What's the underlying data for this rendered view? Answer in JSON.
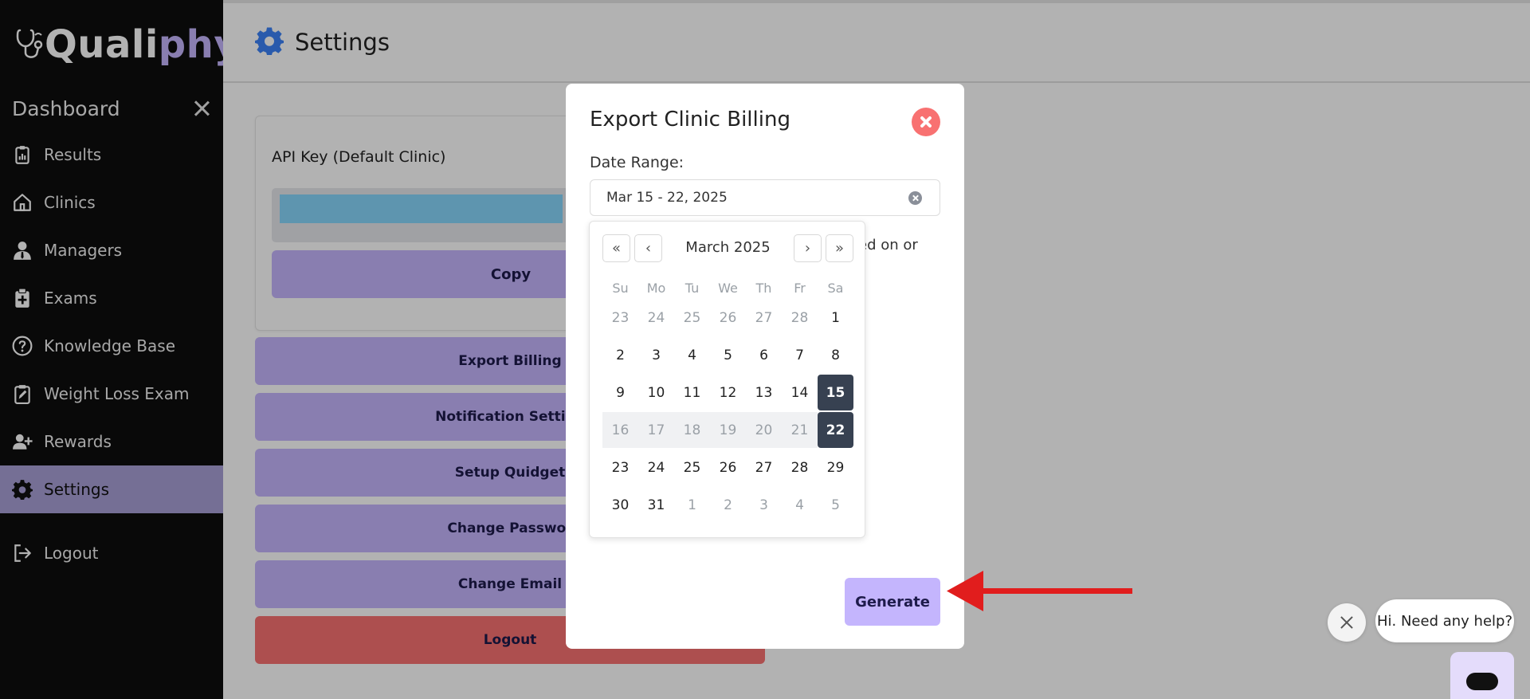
{
  "app": {
    "logo_text_a": "Quali",
    "logo_text_b": "phy"
  },
  "sidebar": {
    "title": "Dashboard",
    "items": [
      {
        "label": "Results",
        "icon": "clipboard-icon"
      },
      {
        "label": "Clinics",
        "icon": "home-icon"
      },
      {
        "label": "Managers",
        "icon": "user-tie-icon"
      },
      {
        "label": "Exams",
        "icon": "clipboard-plus-icon"
      },
      {
        "label": "Knowledge Base",
        "icon": "question-circle-icon"
      },
      {
        "label": "Weight Loss Exam",
        "icon": "clipboard-edit-icon"
      },
      {
        "label": "Rewards",
        "icon": "user-plus-icon"
      },
      {
        "label": "Settings",
        "icon": "gear-icon",
        "active": true
      }
    ],
    "logout_label": "Logout"
  },
  "header": {
    "title": "Settings"
  },
  "settings_card": {
    "title": "API Key (Default Clinic)",
    "copy_label": "Copy"
  },
  "actions": {
    "export_billing": "Export Billing",
    "notification_settings": "Notification Setting",
    "setup_quidget": "Setup Quidget",
    "change_password": "Change Passwor",
    "change_email": "Change Email",
    "logout": "Logout"
  },
  "modal": {
    "title": "Export Clinic Billing",
    "range_label": "Date Range:",
    "range_value": "Mar 15 - 22, 2025",
    "partial_text": "ted on or",
    "generate_label": "Generate"
  },
  "calendar": {
    "month_label": "March 2025",
    "weekdays": [
      "Su",
      "Mo",
      "Tu",
      "We",
      "Th",
      "Fr",
      "Sa"
    ],
    "weeks": [
      [
        {
          "d": "23",
          "t": "muted"
        },
        {
          "d": "24",
          "t": "muted"
        },
        {
          "d": "25",
          "t": "muted"
        },
        {
          "d": "26",
          "t": "muted"
        },
        {
          "d": "27",
          "t": "muted"
        },
        {
          "d": "28",
          "t": "muted"
        },
        {
          "d": "1",
          "t": ""
        }
      ],
      [
        {
          "d": "2",
          "t": ""
        },
        {
          "d": "3",
          "t": ""
        },
        {
          "d": "4",
          "t": ""
        },
        {
          "d": "5",
          "t": ""
        },
        {
          "d": "6",
          "t": ""
        },
        {
          "d": "7",
          "t": ""
        },
        {
          "d": "8",
          "t": ""
        }
      ],
      [
        {
          "d": "9",
          "t": ""
        },
        {
          "d": "10",
          "t": ""
        },
        {
          "d": "11",
          "t": ""
        },
        {
          "d": "12",
          "t": ""
        },
        {
          "d": "13",
          "t": ""
        },
        {
          "d": "14",
          "t": ""
        },
        {
          "d": "15",
          "t": "sel"
        }
      ],
      [
        {
          "d": "16",
          "t": "inrange"
        },
        {
          "d": "17",
          "t": "inrange"
        },
        {
          "d": "18",
          "t": "inrange"
        },
        {
          "d": "19",
          "t": "inrange"
        },
        {
          "d": "20",
          "t": "inrange"
        },
        {
          "d": "21",
          "t": "inrange"
        },
        {
          "d": "22",
          "t": "sel"
        }
      ],
      [
        {
          "d": "23",
          "t": ""
        },
        {
          "d": "24",
          "t": ""
        },
        {
          "d": "25",
          "t": ""
        },
        {
          "d": "26",
          "t": ""
        },
        {
          "d": "27",
          "t": ""
        },
        {
          "d": "28",
          "t": ""
        },
        {
          "d": "29",
          "t": ""
        }
      ],
      [
        {
          "d": "30",
          "t": ""
        },
        {
          "d": "31",
          "t": ""
        },
        {
          "d": "1",
          "t": "muted"
        },
        {
          "d": "2",
          "t": "muted"
        },
        {
          "d": "3",
          "t": "muted"
        },
        {
          "d": "4",
          "t": "muted"
        },
        {
          "d": "5",
          "t": "muted"
        }
      ]
    ]
  },
  "chat": {
    "bubble_text": "Hi. Need any help?"
  },
  "colors": {
    "accent_purple": "#c4b5fd",
    "danger_red": "#f87171",
    "selected_day": "#374151",
    "settings_icon_blue": "#3b82f6"
  }
}
